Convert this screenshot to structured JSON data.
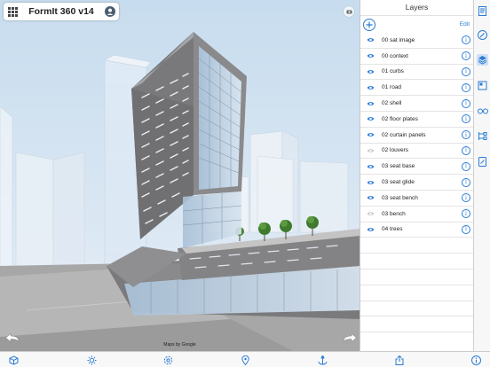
{
  "app": {
    "title": "FormIt 360 v14"
  },
  "viewport": {
    "map_credit": "Maps by Google",
    "sky_color": "#cfe0ef",
    "building_facade_color": "#7d7d7f",
    "glass_tint": "#b9cfe0"
  },
  "layers_panel": {
    "title": "Layers",
    "edit_label": "Edit",
    "accent_color": "#2a7bd5",
    "layers": [
      {
        "name": "00 sat image",
        "visible": true
      },
      {
        "name": "00 context",
        "visible": true
      },
      {
        "name": "01 curbs",
        "visible": true
      },
      {
        "name": "01 road",
        "visible": true
      },
      {
        "name": "02 shell",
        "visible": true
      },
      {
        "name": "02 floor plates",
        "visible": true
      },
      {
        "name": "02 curtain panels",
        "visible": true
      },
      {
        "name": "02 louvers",
        "visible": false
      },
      {
        "name": "03 seat base",
        "visible": true
      },
      {
        "name": "03 seat glide",
        "visible": true
      },
      {
        "name": "03 seat bench",
        "visible": true
      },
      {
        "name": "03 bench",
        "visible": false
      },
      {
        "name": "04 trees",
        "visible": true
      }
    ]
  },
  "tool_strip": {
    "tools": [
      "document-icon",
      "pencil-circle-icon",
      "layers-icon",
      "materials-icon",
      "glasses-icon",
      "hierarchy-icon",
      "tablet-icon"
    ],
    "active_tool": "layers-icon"
  },
  "bottom_toolbar": {
    "tools": [
      "cube-icon",
      "sun-icon",
      "settings-icon",
      "location-pin-icon",
      "anchor-icon",
      "share-icon",
      "info-icon"
    ]
  }
}
